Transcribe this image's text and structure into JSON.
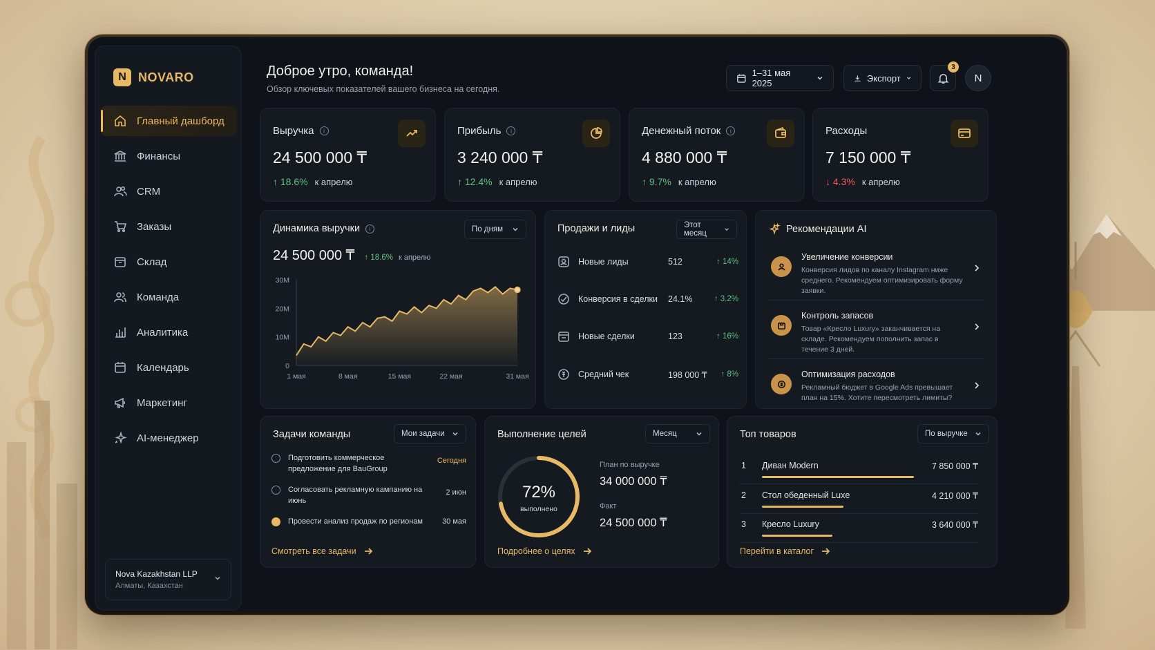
{
  "brand": {
    "badge": "N",
    "name": "NOVARO"
  },
  "sidebar": {
    "items": [
      {
        "label": "Главный дашборд",
        "icon": "home-icon",
        "active": true
      },
      {
        "label": "Финансы",
        "icon": "bank-icon"
      },
      {
        "label": "CRM",
        "icon": "users-icon"
      },
      {
        "label": "Заказы",
        "icon": "cart-icon"
      },
      {
        "label": "Склад",
        "icon": "box-icon"
      },
      {
        "label": "Команда",
        "icon": "team-icon"
      },
      {
        "label": "Аналитика",
        "icon": "bar-chart-icon"
      },
      {
        "label": "Календарь",
        "icon": "calendar-icon"
      },
      {
        "label": "Маркетинг",
        "icon": "megaphone-icon"
      },
      {
        "label": "AI-менеджер",
        "icon": "sparkles-icon"
      }
    ],
    "org": {
      "name": "Nova Kazakhstan LLP",
      "location": "Алматы, Казахстан"
    }
  },
  "header": {
    "greeting": "Доброе утро, команда!",
    "subtitle": "Обзор ключевых показателей вашего бизнеса на сегодня.",
    "date_range": "1–31 мая 2025",
    "export_label": "Экспорт",
    "notifications": "3",
    "avatar": "N"
  },
  "kpis": [
    {
      "title": "Выручка",
      "value": "24 500 000 ₸",
      "delta": "↑ 18.6%",
      "dir": "up",
      "sub": "к апрелю",
      "icon": "trend-up-icon"
    },
    {
      "title": "Прибыль",
      "value": "3 240 000 ₸",
      "delta": "↑ 12.4%",
      "dir": "up",
      "sub": "к апрелю",
      "icon": "pie-icon"
    },
    {
      "title": "Денежный поток",
      "value": "4 880 000 ₸",
      "delta": "↑ 9.7%",
      "dir": "up",
      "sub": "к апрелю",
      "icon": "wallet-icon"
    },
    {
      "title": "Расходы",
      "value": "7 150 000 ₸",
      "delta": "↓ 4.3%",
      "dir": "down",
      "sub": "к апрелю",
      "icon": "card-icon"
    }
  ],
  "revenue": {
    "title": "Динамика выручки",
    "period": "По дням",
    "value": "24 500 000 ₸",
    "delta": "↑ 18.6%",
    "sub": "к апрелю"
  },
  "chart_data": {
    "type": "area",
    "x_ticks": [
      "1 мая",
      "8 мая",
      "15 мая",
      "22 мая",
      "31 мая"
    ],
    "y_ticks": [
      "0",
      "10M",
      "20M",
      "30M"
    ],
    "ylim": [
      0,
      30000000
    ],
    "x": [
      1,
      2,
      3,
      4,
      5,
      6,
      7,
      8,
      9,
      10,
      11,
      12,
      13,
      14,
      15,
      16,
      17,
      18,
      19,
      20,
      21,
      22,
      23,
      24,
      25,
      26,
      27,
      28,
      29,
      30,
      31
    ],
    "values": [
      3500000,
      7500000,
      6500000,
      10000000,
      8500000,
      11500000,
      10500000,
      13500000,
      12000000,
      15000000,
      13500000,
      16500000,
      17000000,
      15500000,
      19000000,
      18000000,
      20500000,
      18500000,
      21000000,
      20000000,
      23000000,
      21500000,
      24500000,
      23000000,
      26000000,
      27000000,
      25500000,
      27500000,
      25000000,
      27000000,
      26500000
    ],
    "grid": false
  },
  "sales": {
    "title": "Продажи и лиды",
    "period": "Этот месяц",
    "rows": [
      {
        "label": "Новые лиды",
        "value": "512",
        "delta": "↑ 14%",
        "icon": "lead-icon"
      },
      {
        "label": "Конверсия в сделки",
        "value": "24.1%",
        "delta": "↑ 3.2%",
        "icon": "target-icon"
      },
      {
        "label": "Новые сделки",
        "value": "123",
        "delta": "↑ 16%",
        "icon": "deal-icon"
      },
      {
        "label": "Средний чек",
        "value": "198 000 ₸",
        "delta": "↑ 8%",
        "icon": "receipt-icon"
      }
    ]
  },
  "ai": {
    "title": "Рекомендации AI",
    "items": [
      {
        "title": "Увеличение конверсии",
        "text": "Конверсия лидов по каналу Instagram ниже среднего. Рекомендуем оптимизировать форму заявки.",
        "icon": "user-icon"
      },
      {
        "title": "Контроль запасов",
        "text": "Товар «Кресло Luxury» заканчивается на складе. Рекомендуем пополнить запас в течение 3 дней.",
        "icon": "package-icon"
      },
      {
        "title": "Оптимизация расходов",
        "text": "Рекламный бюджет в Google Ads превышает план на 15%. Хотите пересмотреть лимиты?",
        "icon": "money-icon"
      }
    ]
  },
  "tasks": {
    "title": "Задачи команды",
    "filter": "Мои задачи",
    "items": [
      {
        "text": "Подготовить коммерческое предложение для BauGroup",
        "date": "Сегодня",
        "done": false
      },
      {
        "text": "Согласовать рекламную кампанию на июнь",
        "date": "2 июн",
        "done": false
      },
      {
        "text": "Провести анализ продаж по регионам",
        "date": "30 мая",
        "done": true
      }
    ],
    "link": "Смотреть все задачи"
  },
  "goals": {
    "title": "Выполнение целей",
    "period": "Месяц",
    "percent": "72%",
    "percent_value": 72,
    "percent_label": "выполнено",
    "plan_label": "План по выручке",
    "plan_value": "34 000 000 ₸",
    "fact_label": "Факт",
    "fact_value": "24 500 000 ₸",
    "link": "Подробнее о целях"
  },
  "products": {
    "title": "Топ товаров",
    "sort": "По выручке",
    "items": [
      {
        "rank": "1",
        "name": "Диван Modern",
        "value": "7 850 000 ₸",
        "amount": 7850000
      },
      {
        "rank": "2",
        "name": "Стол обеденный Luxe",
        "value": "4 210 000 ₸",
        "amount": 4210000
      },
      {
        "rank": "3",
        "name": "Кресло Luxury",
        "value": "3 640 000 ₸",
        "amount": 3640000
      }
    ],
    "link": "Перейти в каталог"
  },
  "colors": {
    "accent": "#e7b865",
    "up": "#5ec283",
    "down": "#ee5858",
    "bg": "#0f1319"
  }
}
